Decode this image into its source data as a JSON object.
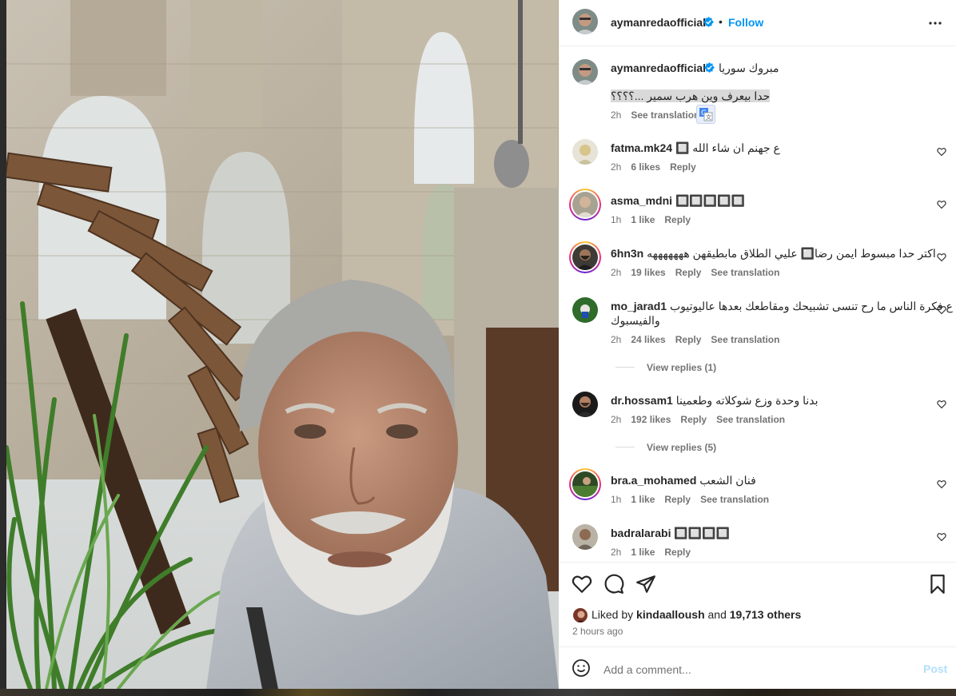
{
  "post": {
    "author": "aymanredaofficial",
    "verified": true,
    "follow_label": "Follow",
    "dot": "•",
    "caption_line1": "مبروك سوريا",
    "caption_line2": "حدا بيعرف وين هرب سمير ...؟؟؟؟",
    "caption_time": "2h",
    "see_translation": "See translation"
  },
  "comments": [
    {
      "user": "fatma.mk24",
      "text": "ع جهنم ان شاء الله 🔲",
      "time": "2h",
      "likes": "6 likes",
      "reply": "Reply",
      "translate": ""
    },
    {
      "user": "asma_mdni",
      "text": "🔲🔲🔲🔲🔲",
      "time": "1h",
      "likes": "1 like",
      "reply": "Reply",
      "translate": ""
    },
    {
      "user": "6hn3n",
      "text": "اكتر حدا مبسوط ايمن رضا🔲 عليي الطلاق مابطيقهن هههههههه",
      "time": "2h",
      "likes": "19 likes",
      "reply": "Reply",
      "translate": "See translation"
    },
    {
      "user": "mo_jarad1",
      "text": "ع فكرة الناس ما رح تنسى تشبيحك ومقاطعك بعدها عاليوتيوب",
      "text2": "والفيسبوك",
      "time": "2h",
      "likes": "24 likes",
      "reply": "Reply",
      "translate": "See translation",
      "view_replies": "View replies (1)"
    },
    {
      "user": "dr.hossam1",
      "text": "بدنا وحدة وزع شوكلاته وطعمينا",
      "time": "2h",
      "likes": "192 likes",
      "reply": "Reply",
      "translate": "See translation",
      "view_replies": "View replies (5)"
    },
    {
      "user": "bra.a_mohamed",
      "text": "فنان الشعب",
      "time": "1h",
      "likes": "1 like",
      "reply": "Reply",
      "translate": "See translation"
    },
    {
      "user": "badralarabi",
      "text": "🔲🔲🔲🔲",
      "time": "2h",
      "likes": "1 like",
      "reply": "Reply",
      "translate": ""
    }
  ],
  "footer": {
    "liked_by_prefix": "Liked by",
    "liked_by_user": "kindaalloush",
    "liked_by_and": "and",
    "liked_by_others": "19,713 others",
    "posted_ago": "2 hours ago"
  },
  "composer": {
    "placeholder": "Add a comment...",
    "post_label": "Post"
  },
  "colors": {
    "accent": "#0095f6",
    "verified": "#0095f6",
    "muted": "#737373",
    "post_disabled": "#b2dffc"
  },
  "icons": [
    "more-icon",
    "heart-icon",
    "comment-icon",
    "share-icon",
    "save-icon",
    "emoji-icon",
    "verified-icon",
    "translate-icon"
  ]
}
